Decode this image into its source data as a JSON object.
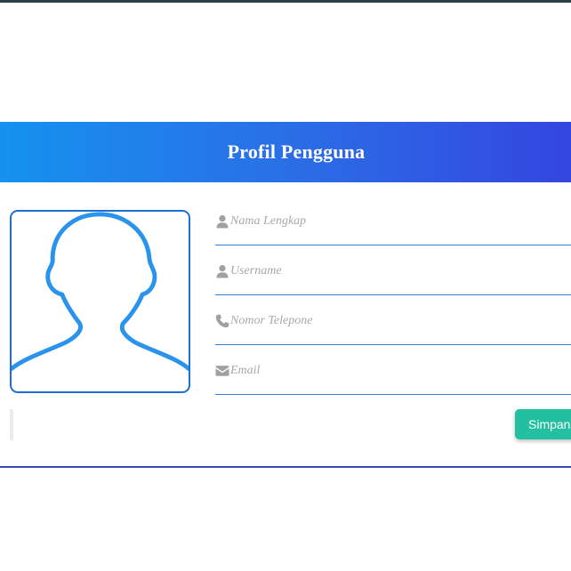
{
  "header": {
    "title": "Profil Pengguna"
  },
  "avatar": {
    "icon": "user-silhouette-icon"
  },
  "form": {
    "fields": [
      {
        "icon": "user-icon",
        "placeholder": "Nama Lengkap",
        "value": ""
      },
      {
        "icon": "user-icon",
        "placeholder": "Username",
        "value": ""
      },
      {
        "icon": "phone-icon",
        "placeholder": "Nomor Telepone",
        "value": ""
      },
      {
        "icon": "envelope-icon",
        "placeholder": "Email",
        "value": ""
      }
    ],
    "save_label": "Simpan"
  },
  "colors": {
    "header_gradient_start": "#1592ef",
    "header_gradient_end": "#3446e0",
    "avatar_stroke": "#2a93ec",
    "field_underline": "#3b7bd6",
    "save_button": "#22bfa0",
    "icon_gray": "#a0a0a0"
  }
}
